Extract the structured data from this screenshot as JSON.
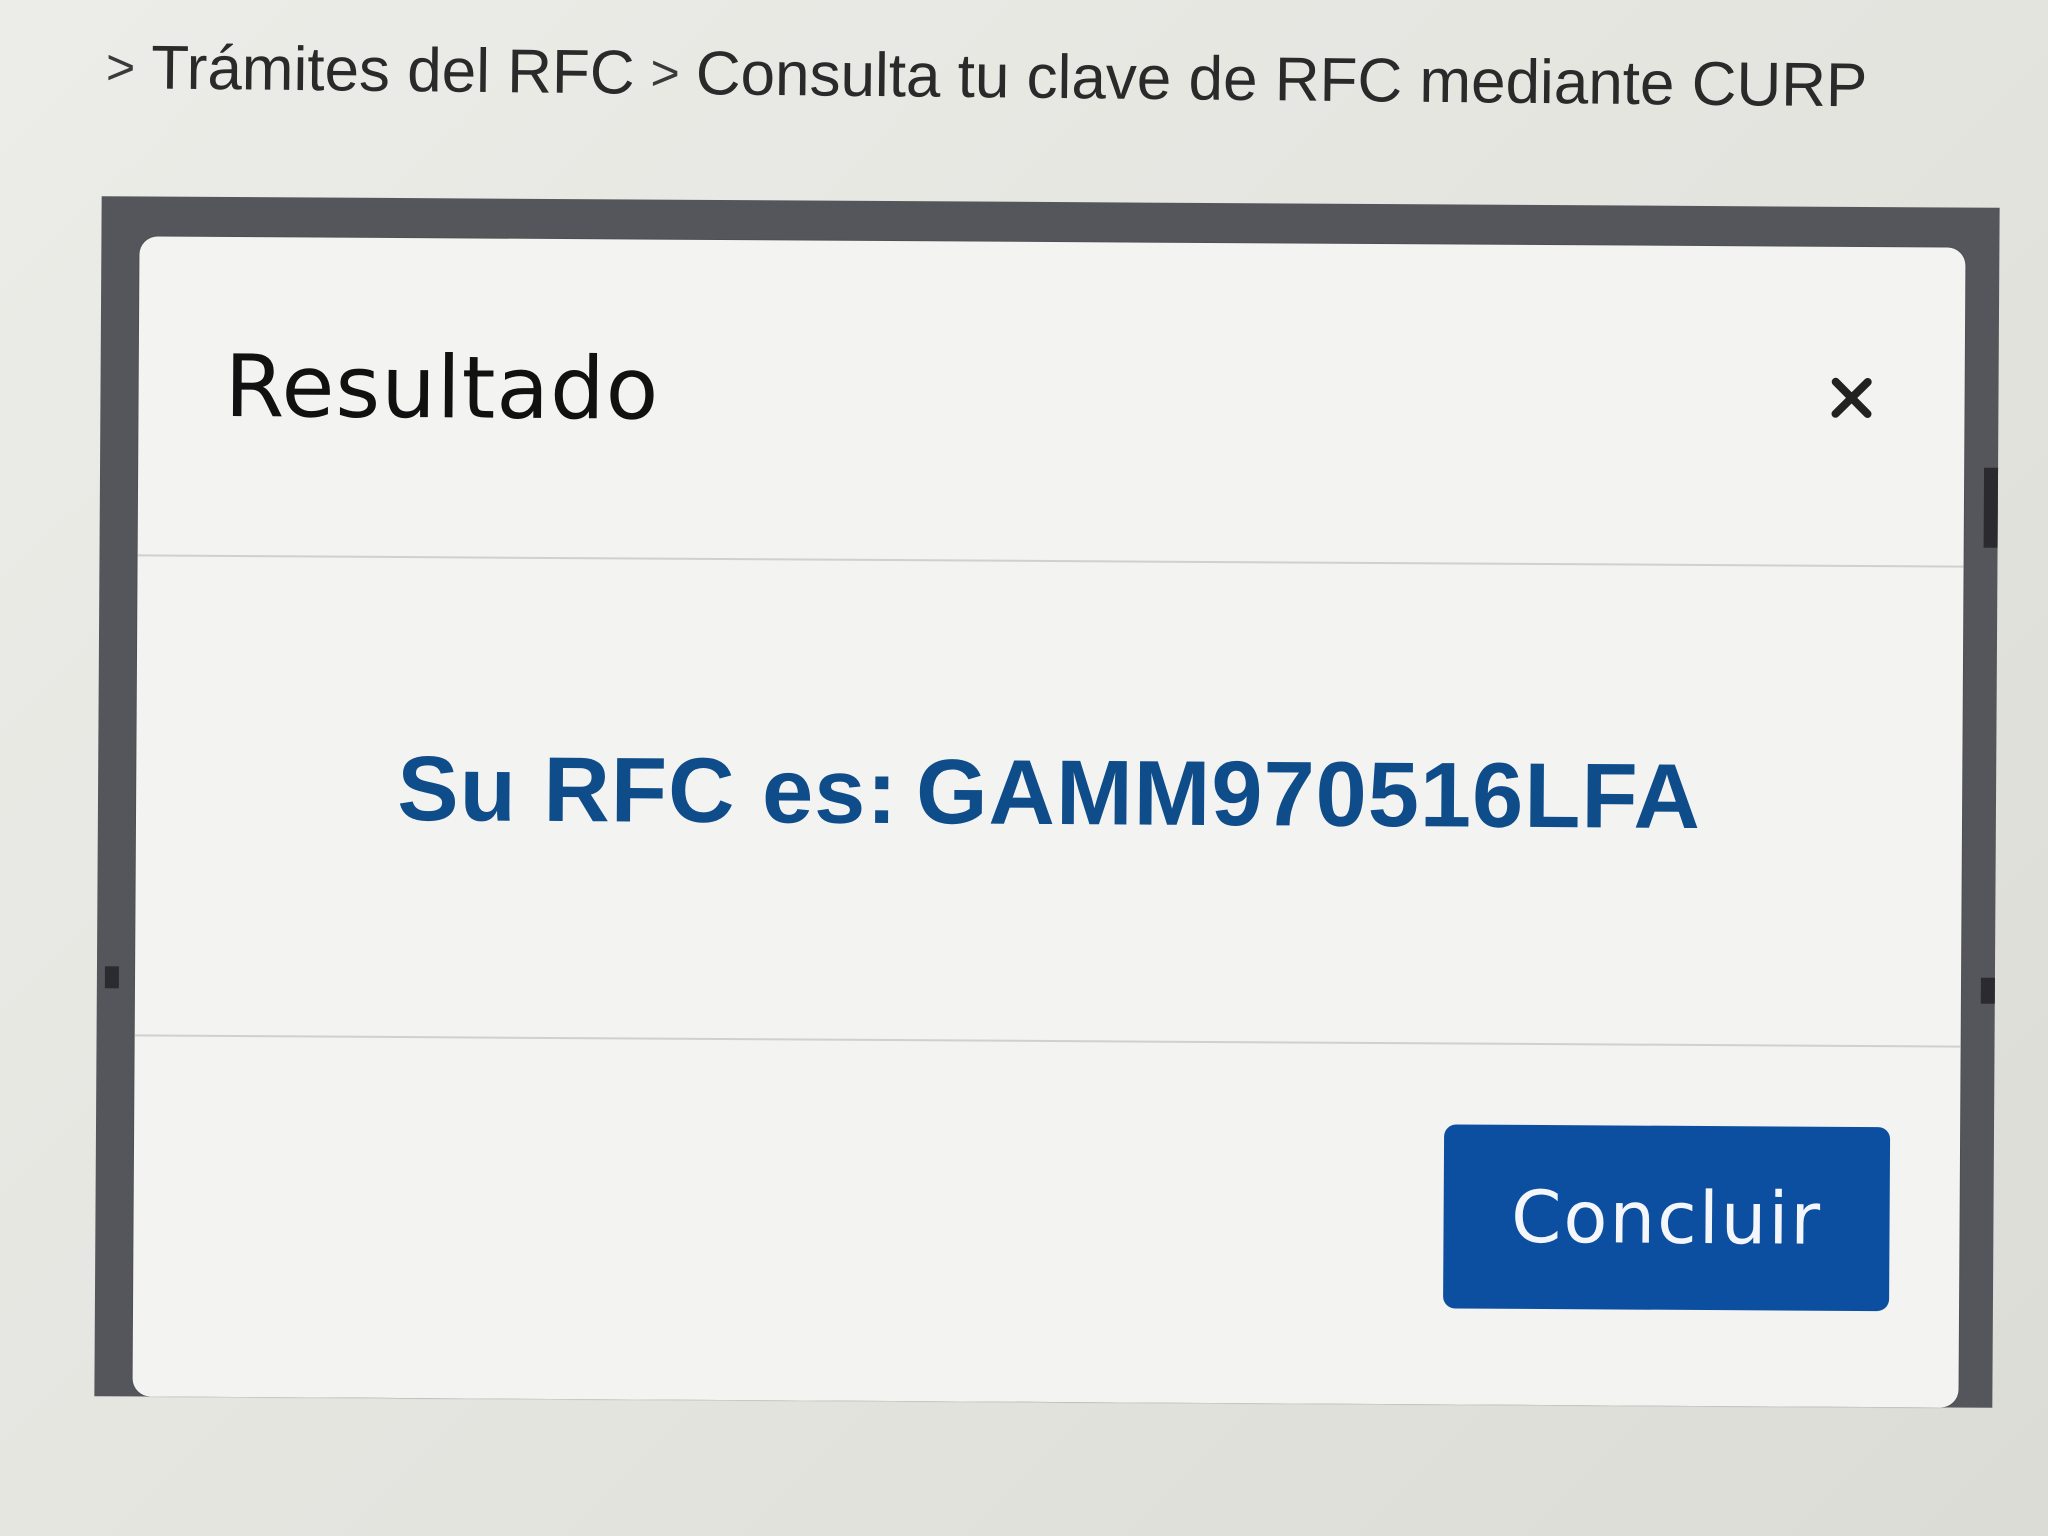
{
  "breadcrumb": {
    "items": [
      "Trámites del RFC",
      "Consulta tu clave de RFC mediante CURP"
    ],
    "separator": ">"
  },
  "modal": {
    "title": "Resultado",
    "close_icon": "close-icon",
    "result_label": "Su RFC es:",
    "rfc_value": "GAMM970516LFA",
    "conclude_label": "Concluir"
  },
  "colors": {
    "result_text": "#0f4c8a",
    "primary_button": "#0c4fa0",
    "backdrop": "#55565b"
  }
}
